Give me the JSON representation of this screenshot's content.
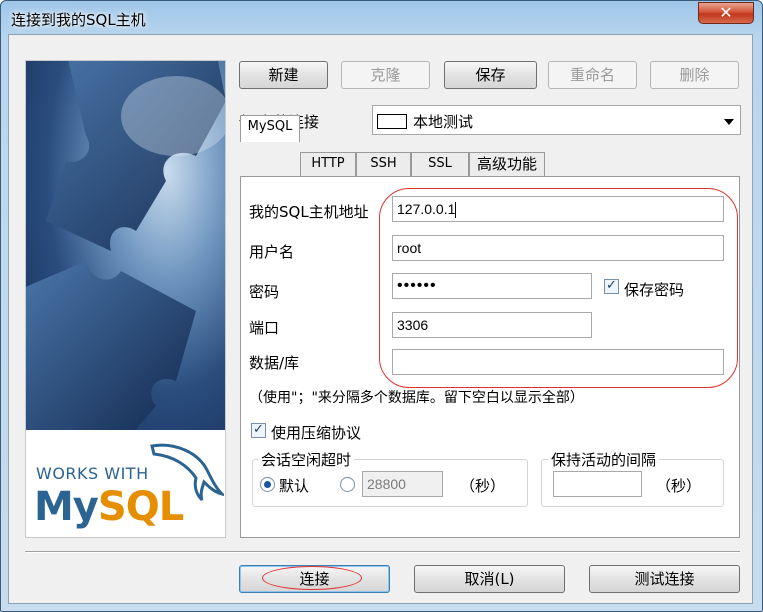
{
  "window": {
    "title": "连接到我的SQL主机",
    "close_glyph": "✕"
  },
  "toolbar": {
    "new_label": "新建",
    "clone_label": "克隆",
    "save_label": "保存",
    "rename_label": "重命名",
    "delete_label": "删除"
  },
  "saved_connections": {
    "label": "保/存的连接",
    "selected": "本地测试"
  },
  "tabs": [
    {
      "label": "MySQL",
      "active": true
    },
    {
      "label": "HTTP"
    },
    {
      "label": "SSH"
    },
    {
      "label": "SSL"
    },
    {
      "label": "高级功能"
    }
  ],
  "mysql": {
    "host_label": "我的SQL主机地址",
    "host_value": "127.0.0.1",
    "user_label": "用户名",
    "user_value": "root",
    "password_label": "密码",
    "password_value": "••••••",
    "save_password_label": "保存密码",
    "save_password_checked": true,
    "port_label": "端口",
    "port_value": "3306",
    "database_label": "数据/库",
    "database_value": "",
    "database_hint": "（使用\"；\"来分隔多个数据库。留下空白以显示全部）",
    "compress_label": "使用压缩协议",
    "compress_checked": true,
    "idle_timeout": {
      "title": "会话空闲超时",
      "default_label": "默认",
      "value": "28800",
      "unit": "（秒）"
    },
    "keepalive": {
      "title": "保持活动的间隔",
      "value": "",
      "unit": "（秒）"
    }
  },
  "footer": {
    "connect_label": "连接",
    "cancel_label": "取消(L)",
    "test_label": "测试连接"
  },
  "logo": {
    "works_with": "WORKS WITH",
    "mysql_my": "My",
    "mysql_sql": "SQL"
  },
  "colors": {
    "annotation_red": "#e0312f",
    "mysql_blue": "#2b6392",
    "mysql_orange": "#e48e00"
  }
}
